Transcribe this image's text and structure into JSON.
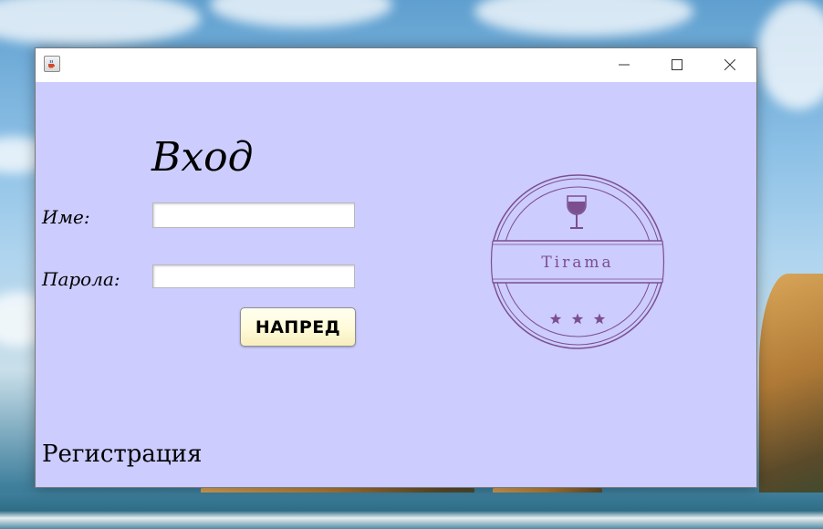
{
  "window": {
    "title": "",
    "icon": "java-cup-icon",
    "controls": {
      "minimize": "minimize-icon",
      "maximize": "maximize-icon",
      "close": "close-icon"
    }
  },
  "login": {
    "heading": "Вход",
    "name_label": "Име:",
    "name_value": "",
    "password_label": "Парола:",
    "password_value": "",
    "submit_label": "НАПРЕД",
    "register_label": "Регистрация"
  },
  "logo": {
    "brand": "Tirama",
    "icon": "wine-glass-icon",
    "stars": 3,
    "color": "#7b4f8e"
  },
  "colors": {
    "window_background": "#ccccff",
    "button_background": "#fffbd8"
  }
}
